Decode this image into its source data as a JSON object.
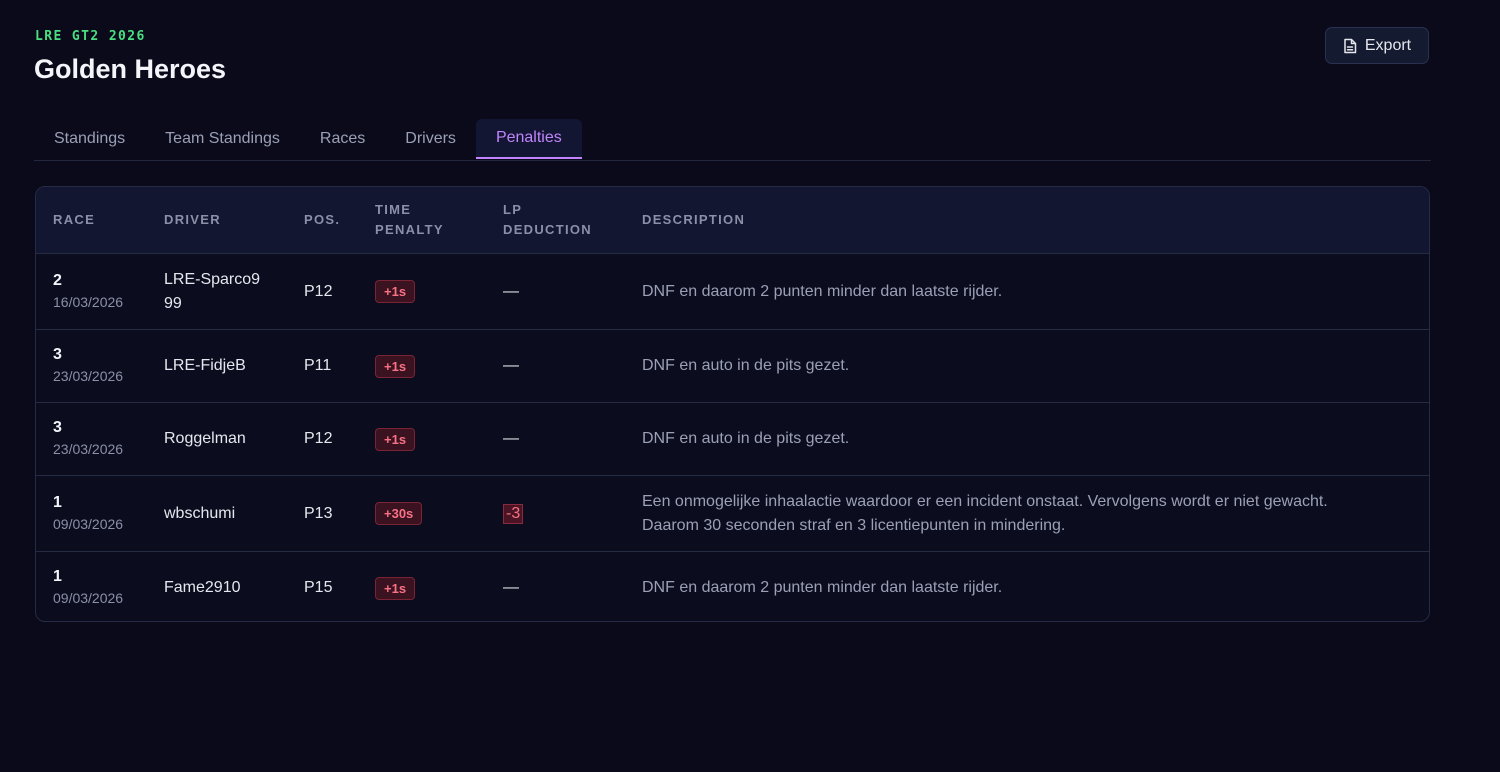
{
  "header": {
    "eyebrow": "LRE GT2 2026",
    "title": "Golden Heroes",
    "export_label": "Export",
    "export_icon": "file-icon"
  },
  "tabs": [
    {
      "label": "Standings",
      "active": false
    },
    {
      "label": "Team Standings",
      "active": false
    },
    {
      "label": "Races",
      "active": false
    },
    {
      "label": "Drivers",
      "active": false
    },
    {
      "label": "Penalties",
      "active": true
    }
  ],
  "table": {
    "columns": {
      "race": "RACE",
      "driver": "DRIVER",
      "pos": "POS.",
      "time_penalty": "TIME PENALTY",
      "lp_deduction": "LP DEDUCTION",
      "description": "DESCRIPTION"
    },
    "rows": [
      {
        "race": "2",
        "date": "16/03/2026",
        "driver": "LRE-Sparco999",
        "pos": "P12",
        "time_penalty": "+1s",
        "lp_deduction": "—",
        "description": "DNF en daarom 2 punten minder dan laatste rijder."
      },
      {
        "race": "3",
        "date": "23/03/2026",
        "driver": "LRE-FidjeB",
        "pos": "P11",
        "time_penalty": "+1s",
        "lp_deduction": "—",
        "description": "DNF en auto in de pits gezet."
      },
      {
        "race": "3",
        "date": "23/03/2026",
        "driver": "Roggelman",
        "pos": "P12",
        "time_penalty": "+1s",
        "lp_deduction": "—",
        "description": "DNF en auto in de pits gezet."
      },
      {
        "race": "1",
        "date": "09/03/2026",
        "driver": "wbschumi",
        "pos": "P13",
        "time_penalty": "+30s",
        "lp_deduction": "-3",
        "description": "Een onmogelijke inhaalactie waardoor er een incident onstaat. Vervolgens wordt er niet gewacht. Daarom 30 seconden straf en 3 licentiepunten in mindering."
      },
      {
        "race": "1",
        "date": "09/03/2026",
        "driver": "Fame2910",
        "pos": "P15",
        "time_penalty": "+1s",
        "lp_deduction": "—",
        "description": "DNF en daarom 2 punten minder dan laatste rijder."
      }
    ]
  },
  "colors": {
    "accent": "#c084fc",
    "eyebrow": "#4ade80",
    "penalty": "#f87185",
    "background": "#0a0a1a"
  }
}
